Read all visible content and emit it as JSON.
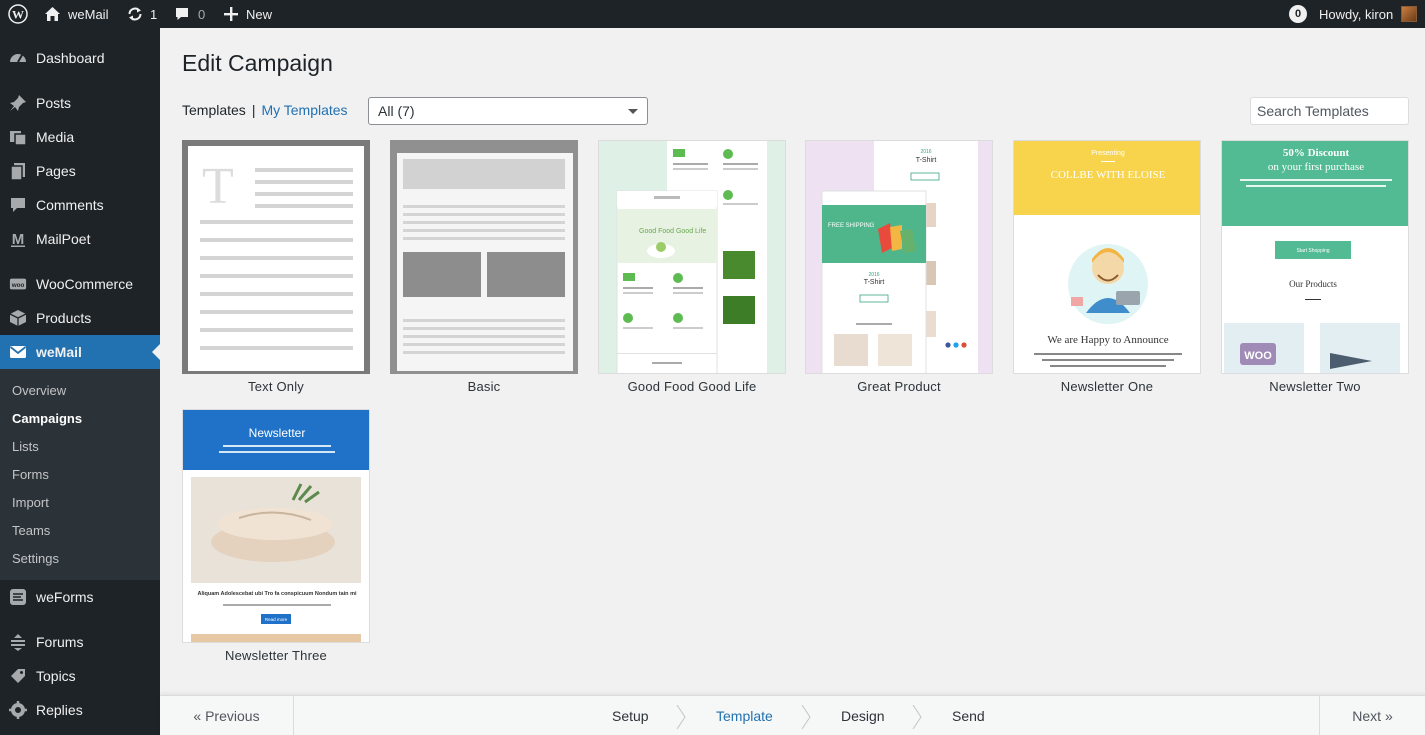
{
  "adminbar": {
    "site_name": "weMail",
    "updates_count": "1",
    "comments_count": "0",
    "new_label": "New",
    "notif_count": "0",
    "greeting": "Howdy, kiron"
  },
  "sidebar": {
    "items": [
      {
        "label": "Dashboard",
        "icon": "dashboard-icon"
      },
      {
        "label": "Posts",
        "icon": "pin-icon"
      },
      {
        "label": "Media",
        "icon": "media-icon"
      },
      {
        "label": "Pages",
        "icon": "pages-icon"
      },
      {
        "label": "Comments",
        "icon": "comment-icon"
      },
      {
        "label": "MailPoet",
        "icon": "mailpoet-icon"
      },
      {
        "label": "WooCommerce",
        "icon": "woo-icon"
      },
      {
        "label": "Products",
        "icon": "box-icon"
      },
      {
        "label": "weMail",
        "icon": "mail-icon"
      },
      {
        "label": "weForms",
        "icon": "weforms-icon"
      },
      {
        "label": "Forums",
        "icon": "forums-icon"
      },
      {
        "label": "Topics",
        "icon": "topics-icon"
      },
      {
        "label": "Replies",
        "icon": "replies-icon"
      }
    ],
    "submenu": [
      "Overview",
      "Campaigns",
      "Lists",
      "Forms",
      "Import",
      "Teams",
      "Settings"
    ]
  },
  "main": {
    "title": "Edit Campaign",
    "tabs": {
      "templates": "Templates",
      "separator": "|",
      "my_templates": "My Templates"
    },
    "filter": {
      "selected": "All (7)"
    },
    "search": {
      "placeholder": "Search Templates"
    },
    "templates": [
      {
        "name": "Text Only"
      },
      {
        "name": "Basic"
      },
      {
        "name": "Good Food Good Life"
      },
      {
        "name": "Great Product"
      },
      {
        "name": "Newsletter One"
      },
      {
        "name": "Newsletter Two"
      },
      {
        "name": "Newsletter Three"
      }
    ],
    "thumb_text": {
      "t_letter": "T",
      "food_title": "Good Food Good Life",
      "gp_year": "2016",
      "gp_shirt": "T-Shirt",
      "gp_free": "FREE SHIPPING",
      "n1_presenting": "Presenting",
      "n1_title": "COLLBE WITH ELOISE",
      "n1_announce": "We are Happy to Announce",
      "n2_discount": "50% Discount",
      "n2_purchase": "on your first purchase",
      "n2_shop": "Start Shopping",
      "n2_products": "Our Products",
      "n2_woo": "WOO",
      "n3_title": "Newsletter",
      "n3_heading": "Aliquam Adolescebat ubi Tro fa conspicuum Nondum tain mi",
      "n3_read": "Read more"
    }
  },
  "wizard": {
    "previous": "« Previous",
    "next": "Next »",
    "steps": [
      "Setup",
      "Template",
      "Design",
      "Send"
    ],
    "active_step": "Template"
  },
  "colors": {
    "accent": "#2271b1",
    "admin_dark": "#1d2327",
    "submenu_bg": "#2c3338",
    "newsletter_one_yellow": "#f7d44c",
    "newsletter_two_green": "#52bb93",
    "newsletter_three_blue": "#2072c9"
  }
}
